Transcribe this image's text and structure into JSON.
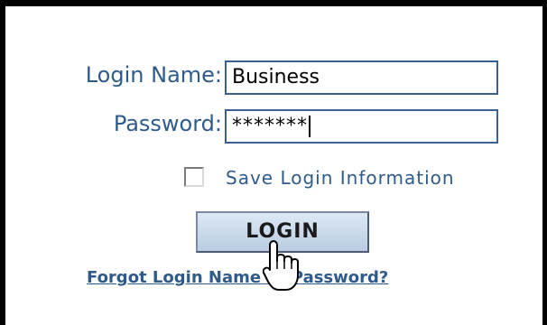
{
  "form": {
    "login_name_label": "Login Name:",
    "login_name_value": "Business",
    "password_label": "Password:",
    "password_value": "*******",
    "save_login_label": "Save Login Information",
    "save_login_checked": false,
    "login_button_label": "LOGIN",
    "forgot_link_text": "Forgot Login Name or Password?"
  },
  "colors": {
    "label_blue": "#2f5b8a",
    "field_border": "#3b5f8f",
    "button_top": "#dde8f4",
    "button_bottom": "#b9cce2"
  },
  "icons": {
    "cursor": "hand-pointer-icon"
  }
}
